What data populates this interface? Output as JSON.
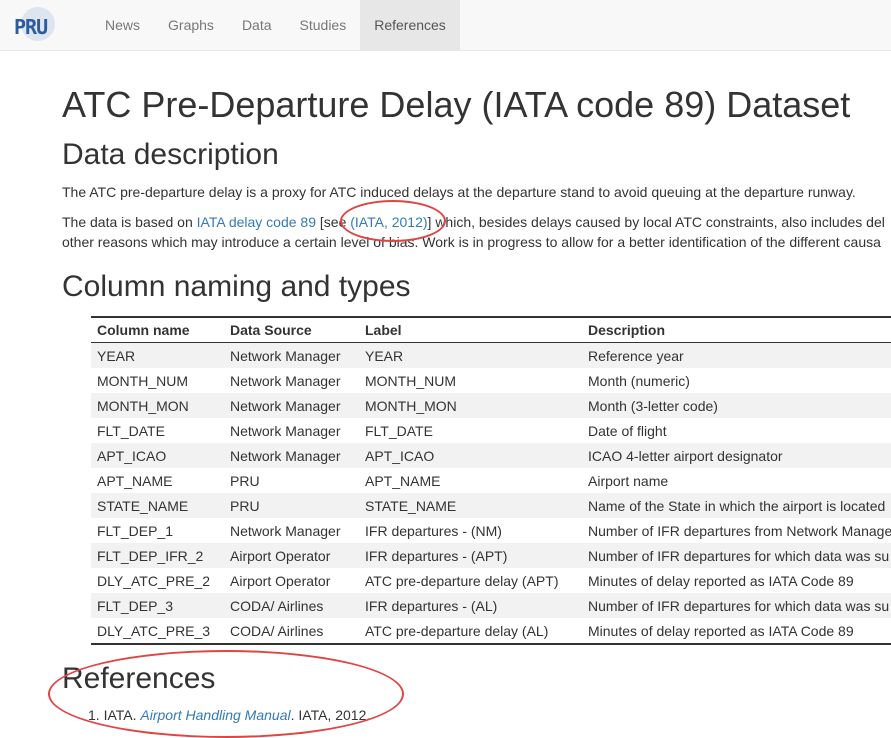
{
  "brand": {
    "logo_text": "PRU"
  },
  "nav": [
    {
      "label": "News"
    },
    {
      "label": "Graphs"
    },
    {
      "label": "Data"
    },
    {
      "label": "Studies"
    },
    {
      "label": "References",
      "active": true
    }
  ],
  "title": "ATC Pre-Departure Delay (IATA code 89) Dataset",
  "data_description": {
    "heading": "Data description",
    "para1": "The ATC pre-departure delay is a proxy for ATC induced delays at the departure stand to avoid queuing at the departure runway.",
    "para2": {
      "prefix": "The data is based on ",
      "link1": "IATA delay code 89",
      "mid1": " [see ",
      "link2": "(IATA, 2012)",
      "mid2": "] which, besides delays caused by local ATC constraints, also includes del",
      "line2": "other reasons which may introduce a certain level of bias. Work is in progress to allow for a better identification of the different causa"
    }
  },
  "columns_section": {
    "heading": "Column naming and types",
    "headers": [
      "Column name",
      "Data Source",
      "Label",
      "Description"
    ],
    "rows": [
      [
        "YEAR",
        "Network Manager",
        "YEAR",
        "Reference year"
      ],
      [
        "MONTH_NUM",
        "Network Manager",
        "MONTH_NUM",
        "Month (numeric)"
      ],
      [
        "MONTH_MON",
        "Network Manager",
        "MONTH_MON",
        "Month (3-letter code)"
      ],
      [
        "FLT_DATE",
        "Network Manager",
        "FLT_DATE",
        "Date of flight"
      ],
      [
        "APT_ICAO",
        "Network Manager",
        "APT_ICAO",
        "ICAO 4-letter airport designator"
      ],
      [
        "APT_NAME",
        "PRU",
        "APT_NAME",
        "Airport name"
      ],
      [
        "STATE_NAME",
        "PRU",
        "STATE_NAME",
        "Name of the State in which the airport is located"
      ],
      [
        "FLT_DEP_1",
        "Network Manager",
        "IFR departures - (NM)",
        "Number of IFR departures from Network Manage"
      ],
      [
        "FLT_DEP_IFR_2",
        "Airport Operator",
        "IFR departures - (APT)",
        "Number of IFR departures for which data was su"
      ],
      [
        "DLY_ATC_PRE_2",
        "Airport Operator",
        "ATC pre-departure delay (APT)",
        "Minutes of delay reported as IATA Code 89"
      ],
      [
        "FLT_DEP_3",
        "CODA/ Airlines",
        "IFR departures - (AL)",
        "Number of IFR departures for which data was su"
      ],
      [
        "DLY_ATC_PRE_3",
        "CODA/ Airlines",
        "ATC pre-departure delay (AL)",
        "Minutes of delay reported as IATA Code 89"
      ]
    ]
  },
  "references": {
    "heading": "References",
    "items": [
      {
        "number": "1.",
        "author": "IATA. ",
        "title": "Airport Handling Manual",
        "rest": ". IATA, 2012."
      }
    ]
  },
  "colors": {
    "link": "#337ab7",
    "annotation": "#e04545"
  }
}
